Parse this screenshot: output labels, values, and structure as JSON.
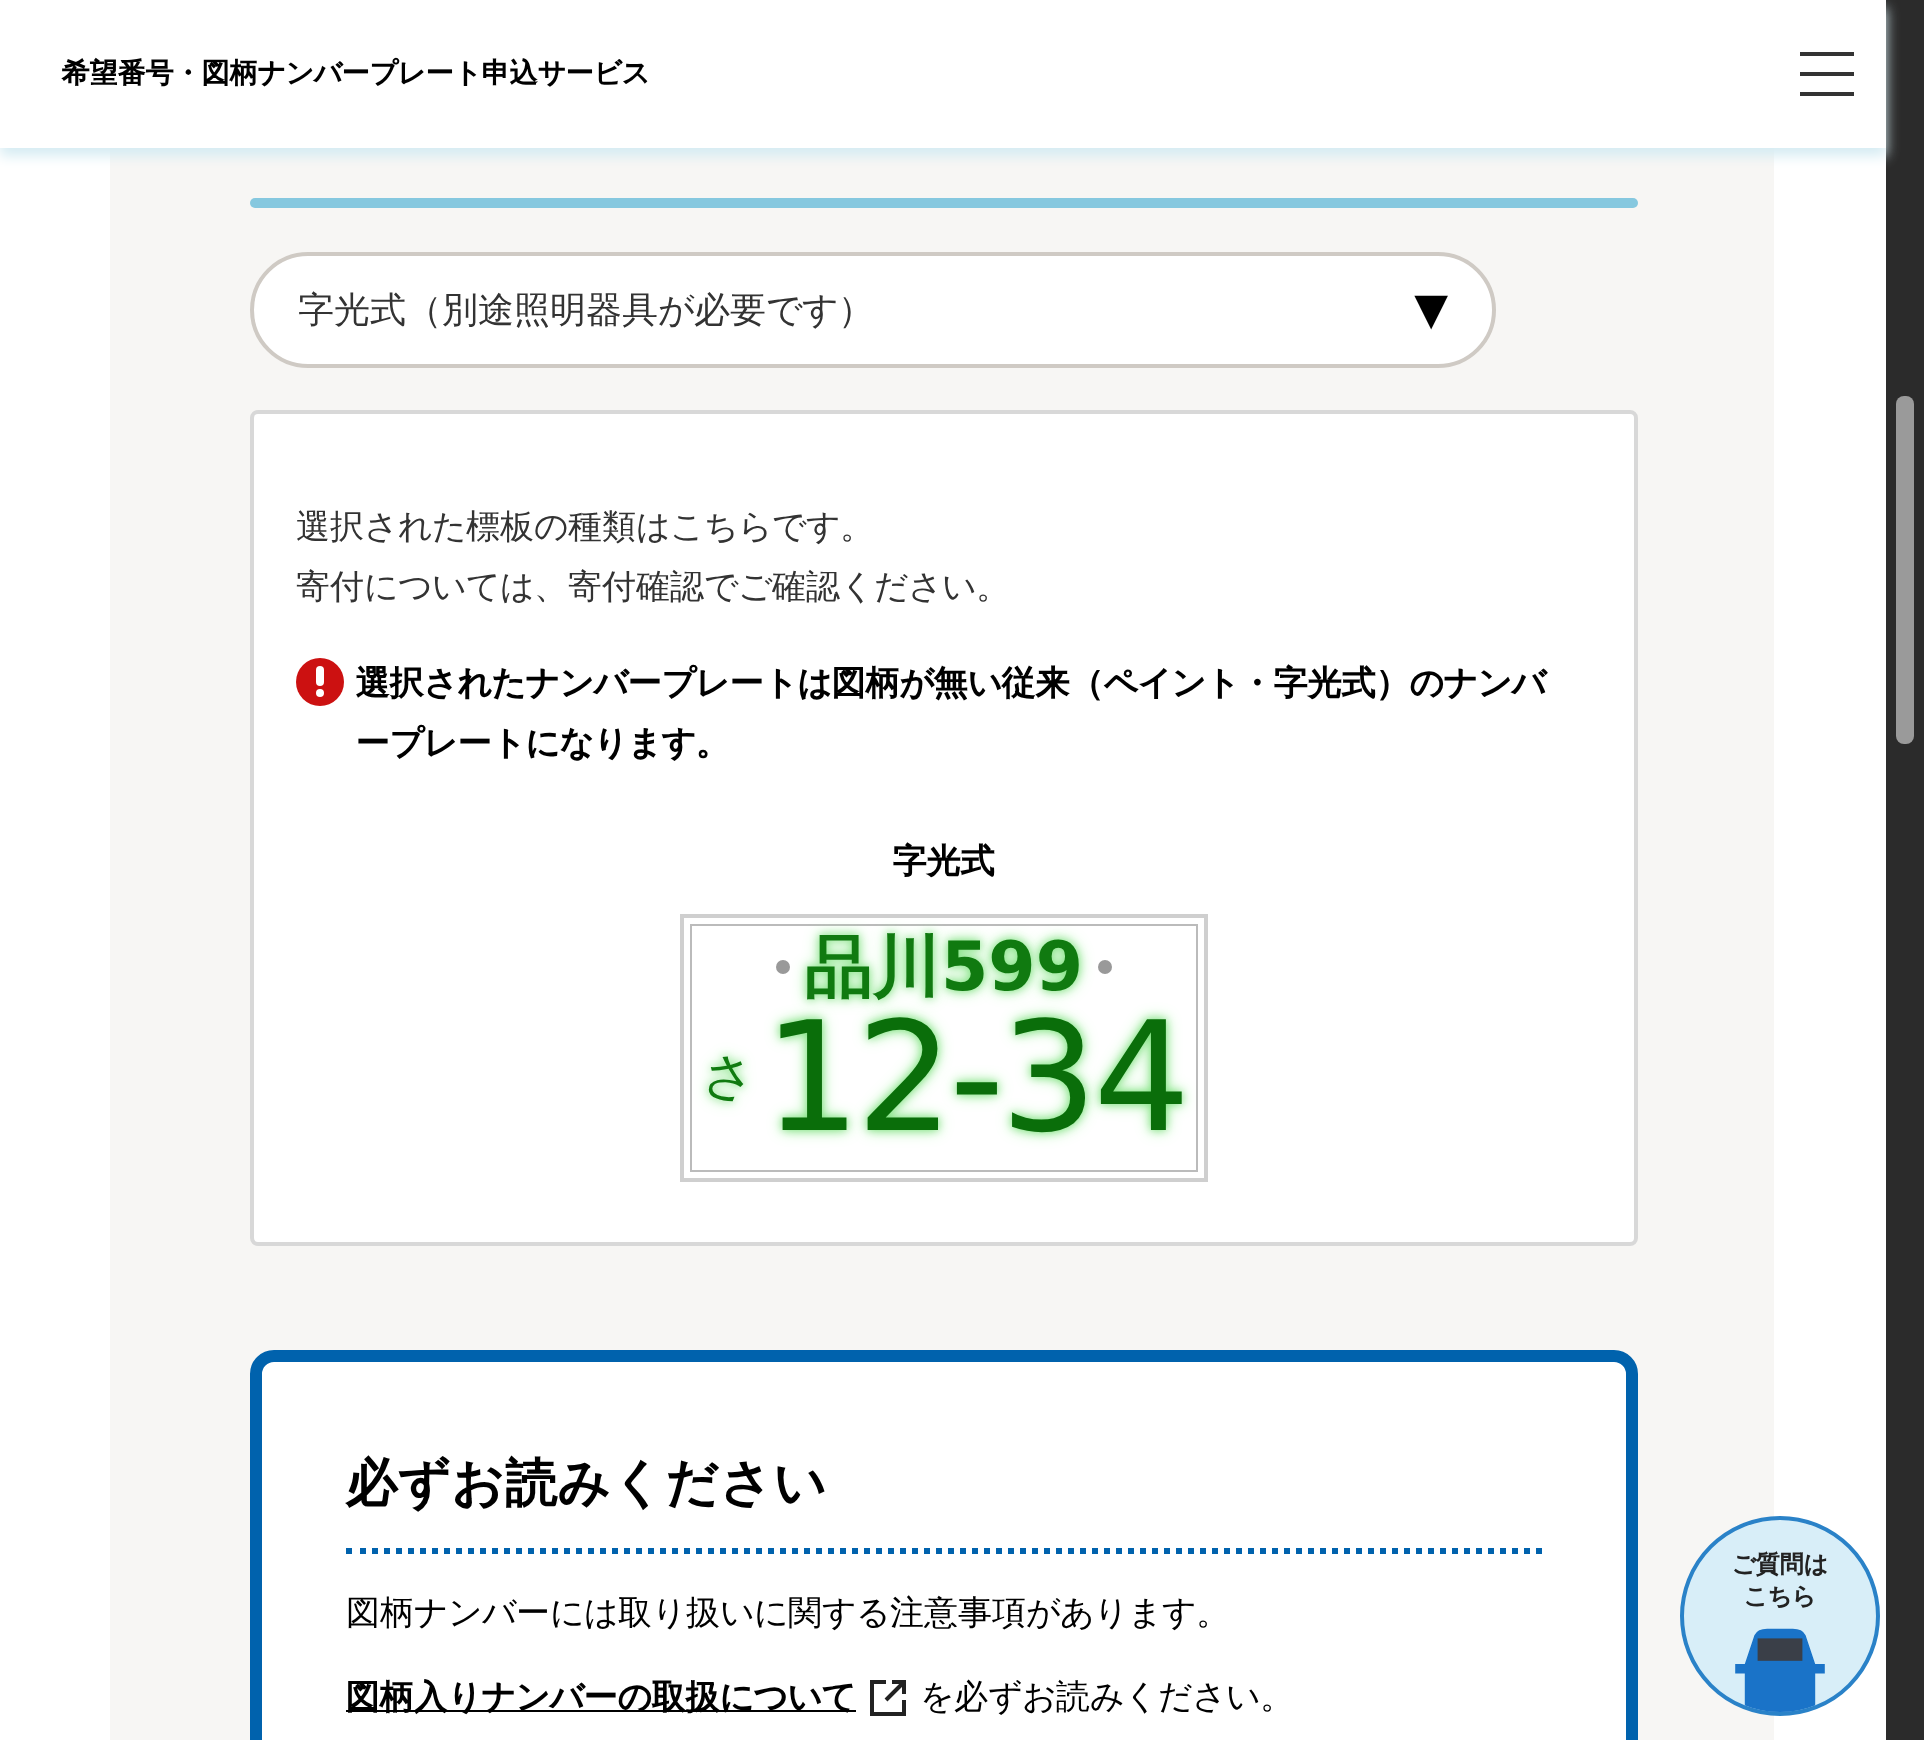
{
  "header": {
    "title": "希望番号・図柄ナンバープレート申込サービス"
  },
  "select": {
    "value": "字光式（別途照明器具が必要です）",
    "arrow": "▼"
  },
  "info_card": {
    "lines": [
      "選択された標板の種類はこちらです。",
      "寄付については、寄付確認でご確認ください。"
    ],
    "alert": "選択されたナンバープレートは図柄が無い従来（ペイント・字光式）のナンバープレートになります。",
    "plate_label": "字光式",
    "plate": {
      "region": "品川599",
      "kana": "さ",
      "number": "12-34"
    }
  },
  "notice": {
    "title": "必ずお読みください",
    "text": "図柄ナンバーには取り扱いに関する注意事項があります。",
    "link": "図柄入りナンバーの取扱について",
    "link_suffix": "を必ずお読みください。"
  },
  "help_button": {
    "label_lines": [
      "ご質問は",
      "こちら"
    ]
  }
}
